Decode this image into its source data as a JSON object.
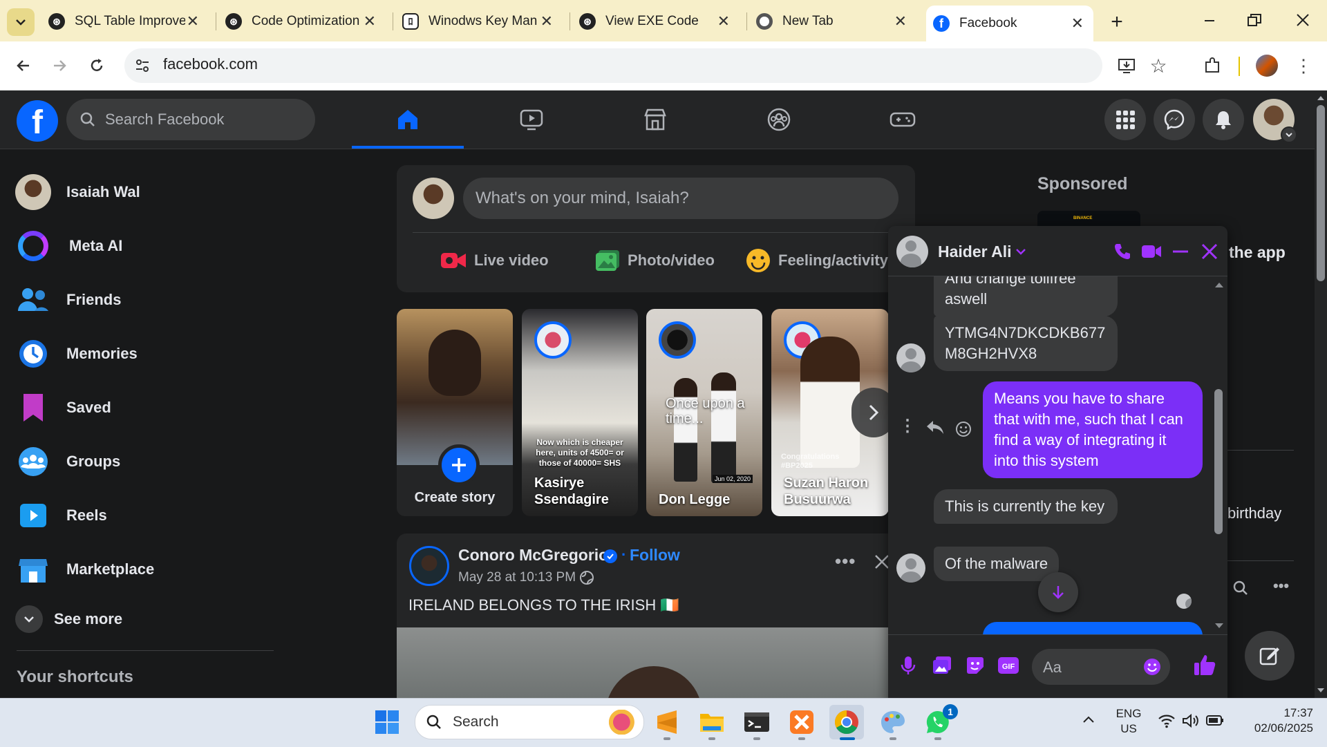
{
  "browser": {
    "tabs": [
      {
        "label": "SQL Table Improve",
        "icon": "chatgpt-icon"
      },
      {
        "label": "Code Optimization",
        "icon": "chatgpt-icon"
      },
      {
        "label": "Winodws Key Man",
        "icon": "app-icon"
      },
      {
        "label": "View EXE Code",
        "icon": "chatgpt-icon"
      },
      {
        "label": "New Tab",
        "icon": "chrome-icon"
      },
      {
        "label": "Facebook",
        "icon": "facebook-icon",
        "active": true
      }
    ],
    "new_tab_symbol": "+",
    "url": "facebook.com"
  },
  "facebook": {
    "search_placeholder": "Search Facebook",
    "sidebar": [
      {
        "label": "Isaiah Wal",
        "icon": "profile-avatar"
      },
      {
        "label": "Meta AI",
        "icon": "meta-ai-icon"
      },
      {
        "label": "Friends",
        "icon": "friends-icon"
      },
      {
        "label": "Memories",
        "icon": "memories-icon"
      },
      {
        "label": "Saved",
        "icon": "saved-icon"
      },
      {
        "label": "Groups",
        "icon": "groups-icon"
      },
      {
        "label": "Reels",
        "icon": "reels-icon"
      },
      {
        "label": "Marketplace",
        "icon": "marketplace-icon"
      }
    ],
    "see_more": "See more",
    "shortcuts_heading": "Your shortcuts",
    "composer": {
      "placeholder": "What's on your mind, Isaiah?",
      "actions": [
        "Live video",
        "Photo/video",
        "Feeling/activity"
      ]
    },
    "stories": [
      {
        "name": "Create story",
        "type": "create"
      },
      {
        "name": "Kasirye Ssendagire",
        "caption": "Now which is cheaper here, units of 4500= or those of 40000= SHS"
      },
      {
        "name": "Don Legge",
        "caption": "Once upon a time...",
        "date_stamp": "Jun 02, 2020"
      },
      {
        "name": "Suzan Haron Busuurwa",
        "caption": "Congratulations #BP2025"
      }
    ],
    "post": {
      "author": "Conoro McGregorio",
      "follow": "Follow",
      "separator": "·",
      "timestamp": "May 28 at 10:13 PM",
      "text": "IRELAND BELONGS TO THE IRISH 🇮🇪"
    },
    "right_column": {
      "sponsored": "Sponsored",
      "ad_brand": "BINANCE",
      "partial_text_1": "the app",
      "partial_text_2": "birthday"
    },
    "chat": {
      "contact": "Haider Ali",
      "messages": [
        {
          "from": "them",
          "text": "And change tollfree aswell"
        },
        {
          "from": "them",
          "text": "YTMG4N7DKCDKB677 M8GH2HVX8"
        },
        {
          "from": "me",
          "text": "Means you have to share that with me, such that I can find a way of integrating it into this system"
        },
        {
          "from": "them",
          "text": "This is currently the key"
        },
        {
          "from": "them",
          "text": "Of the malware"
        }
      ],
      "input_placeholder": "Aa"
    }
  },
  "taskbar": {
    "search_label": "Search",
    "language": "ENG",
    "region": "US",
    "time": "17:37",
    "date": "02/06/2025",
    "whatsapp_badge": "1"
  },
  "colors": {
    "fb_blue": "#0866ff",
    "messenger_purple": "#a033ff",
    "tab_strip": "#f7efc9",
    "fb_bg": "#18191a",
    "fb_card": "#242526"
  }
}
